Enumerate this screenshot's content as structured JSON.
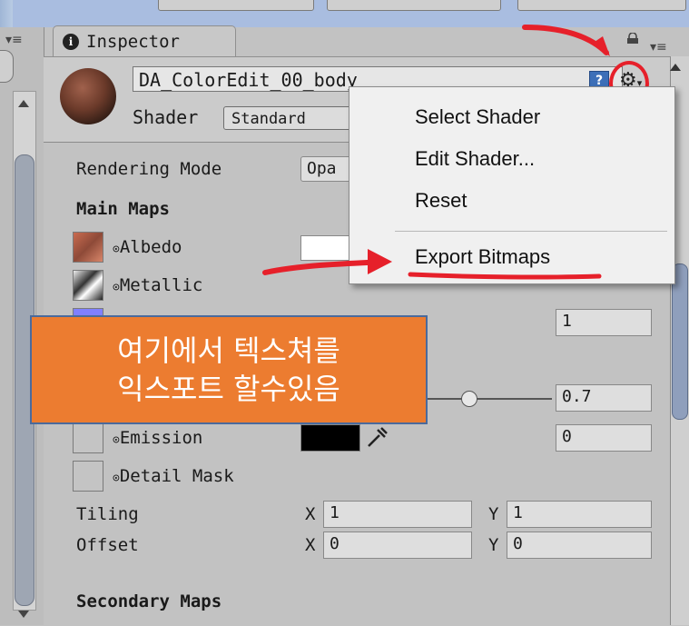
{
  "tab": {
    "title": "Inspector"
  },
  "material": {
    "name": "DA_ColorEdit_00_body",
    "shader_label": "Shader",
    "shader_value": "Standard"
  },
  "props": {
    "rendering_mode_label": "Rendering Mode",
    "rendering_mode_value": "Opa",
    "main_maps": "Main Maps",
    "albedo": "Albedo",
    "metallic": "Metallic",
    "normal_value": "1",
    "smoothness_value": "0.7",
    "emission": "Emission",
    "emission_value": "0",
    "detail_mask": "Detail Mask",
    "tiling": "Tiling",
    "offset": "Offset",
    "x_label": "X",
    "y_label": "Y",
    "tiling_x": "1",
    "tiling_y": "1",
    "offset_x": "0",
    "offset_y": "0",
    "secondary_maps": "Secondary Maps"
  },
  "context_menu": {
    "items": [
      "Select Shader",
      "Edit Shader...",
      "Reset",
      "Export Bitmaps"
    ]
  },
  "callout": {
    "line1": "여기에서 텍스쳐를",
    "line2": "익스포트 할수있음"
  },
  "colors": {
    "annotation_red": "#e6202a",
    "callout_orange": "#ec7c30"
  },
  "icons": {
    "info": "i",
    "help": "?",
    "gear": "⚙",
    "circle": "⊙"
  }
}
